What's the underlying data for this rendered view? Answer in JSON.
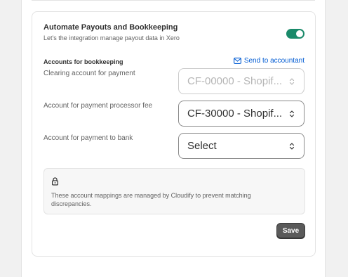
{
  "card": {
    "title": "Automate Payouts and Bookkeeping",
    "subtitle": "Let's the integration manage payout data in Xero",
    "toggle_on": true,
    "accent_color": "#1a8a6a"
  },
  "accounts": {
    "heading": "Accounts for bookkeeping",
    "send_link_label": "Send to accountant",
    "send_link_icon": "mail-icon",
    "rows": [
      {
        "label": "Clearing account for payment",
        "value": "CF-00000 - Shopif...",
        "disabled": true
      },
      {
        "label": "Account for payment processor fee",
        "value": "CF-30000 - Shopif...",
        "disabled": false
      },
      {
        "label": "Account for payment to bank",
        "value": "Select",
        "disabled": false
      }
    ]
  },
  "notice": {
    "icon": "lock-icon",
    "text": "These account mappings are managed by Cloudify to prevent matching discrepancies."
  },
  "actions": {
    "save_label": "Save"
  }
}
